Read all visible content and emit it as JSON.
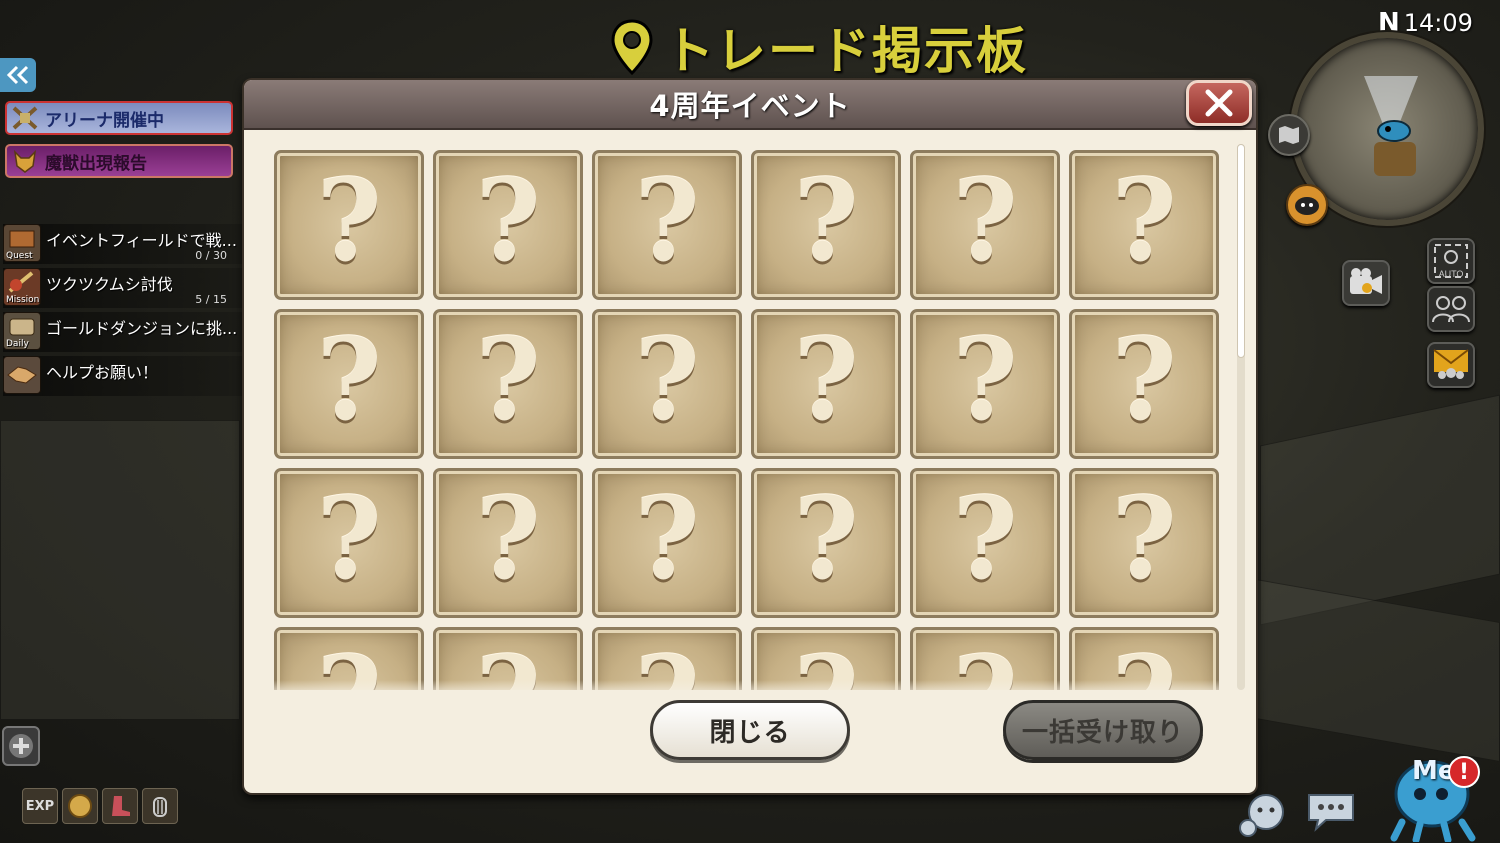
{
  "location": {
    "name": "トレード掲示板"
  },
  "clock": {
    "north": "N",
    "time": "14:09"
  },
  "minimap": {
    "auto_label": "AUTO"
  },
  "hud": {
    "banners": [
      {
        "label": "アリーナ開催中"
      },
      {
        "label": "魔獣出現報告"
      }
    ],
    "quests": [
      {
        "tag": "Quest",
        "title": "イベントフィールドで戦...",
        "count": "0 / 30"
      },
      {
        "tag": "Mission",
        "title": "ツクツクムシ討伐",
        "count": "5 / 15"
      },
      {
        "tag": "Daily",
        "title": "ゴールドダンジョンに挑...",
        "count": ""
      },
      {
        "tag": "",
        "title": "ヘルプお願い！",
        "count": ""
      }
    ],
    "bottom_icons": [
      "EXP",
      "",
      "",
      ""
    ]
  },
  "modal": {
    "title": "4周年イベント",
    "tile_symbol": "?",
    "close_button": "閉じる",
    "claim_button": "一括受け取り"
  },
  "bottom_right": {
    "me_label": "Me",
    "alert": "!"
  },
  "colors": {
    "title_yellow": "#d8cf3c",
    "modal_bg": "#f4eee0",
    "header": "#6f6260",
    "tile": "#c6b085",
    "close_red": "#a8443d"
  }
}
